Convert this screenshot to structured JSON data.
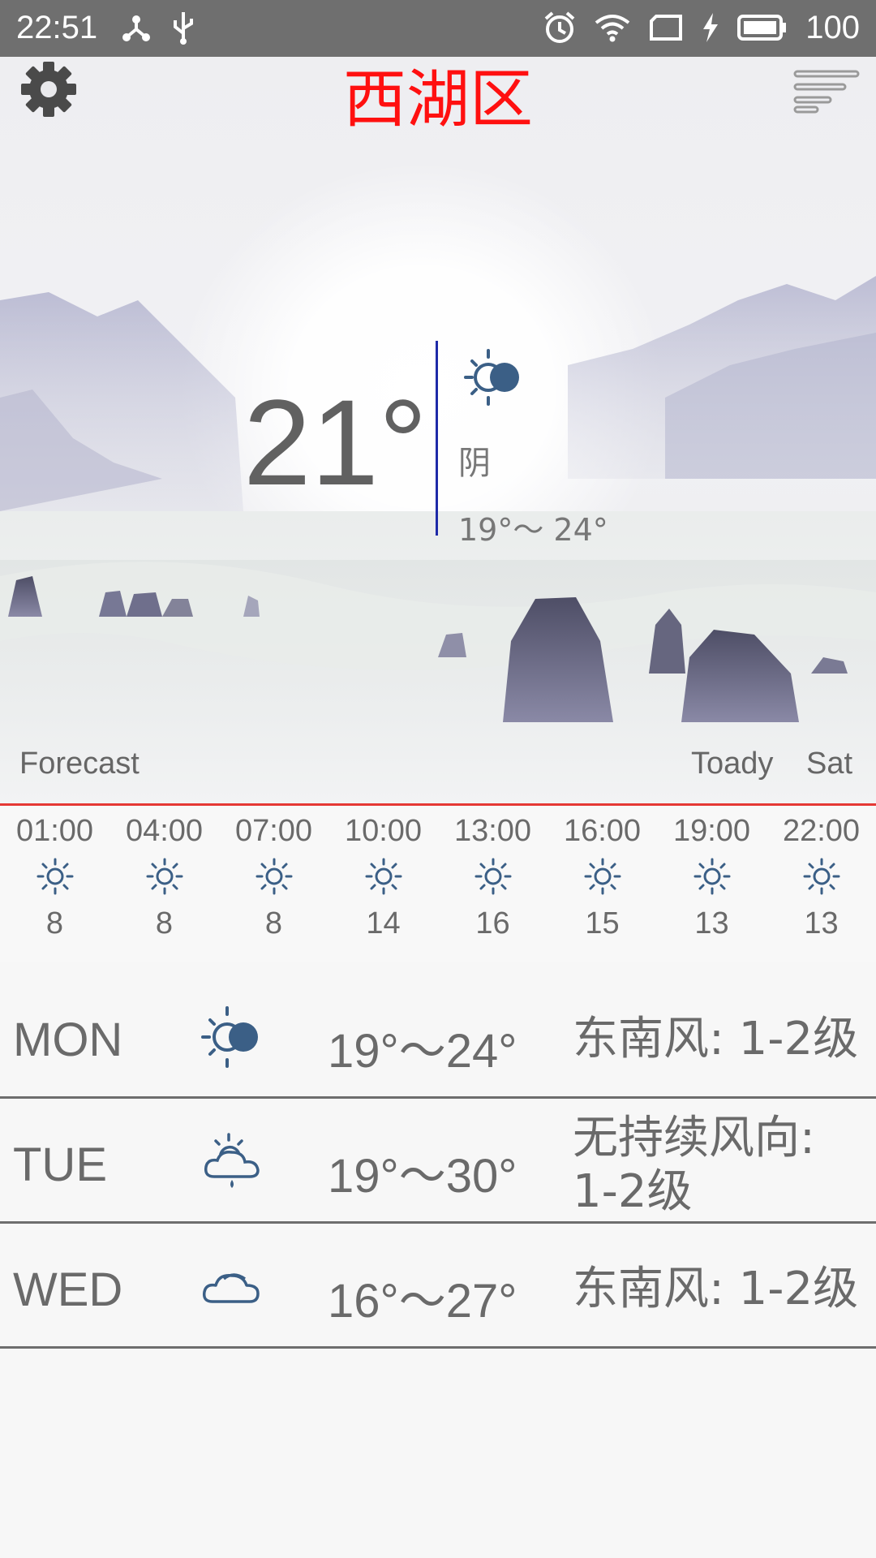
{
  "status_bar": {
    "time": "22:51",
    "battery": "100"
  },
  "header": {
    "title": "西湖区"
  },
  "current": {
    "temp": "21°",
    "condition": "阴",
    "range": "19°～ 24°",
    "icon": "sun-moon-icon"
  },
  "labels": {
    "forecast": "Forecast",
    "today": "Toady",
    "sat": "Sat"
  },
  "hourly": [
    {
      "time": "01:00",
      "value": "8",
      "icon": "sun-icon"
    },
    {
      "time": "04:00",
      "value": "8",
      "icon": "sun-icon"
    },
    {
      "time": "07:00",
      "value": "8",
      "icon": "sun-icon"
    },
    {
      "time": "10:00",
      "value": "14",
      "icon": "sun-icon"
    },
    {
      "time": "13:00",
      "value": "16",
      "icon": "sun-icon"
    },
    {
      "time": "16:00",
      "value": "15",
      "icon": "sun-icon"
    },
    {
      "time": "19:00",
      "value": "13",
      "icon": "sun-icon"
    },
    {
      "time": "22:00",
      "value": "13",
      "icon": "sun-icon"
    }
  ],
  "daily": [
    {
      "day": "MON",
      "range": "19°～24°",
      "wind": "东南风: 1-2级",
      "icon": "sun-moon-icon"
    },
    {
      "day": "TUE",
      "range": "19°～30°",
      "wind": "无持续风向: 1-2级",
      "icon": "sun-cloud-rain-icon"
    },
    {
      "day": "WED",
      "range": "16°～27°",
      "wind": "东南风: 1-2级",
      "icon": "cloud-icon"
    }
  ],
  "colors": {
    "title": "#ff1010",
    "accent_line": "#1e2aa8",
    "hero_border": "#e53935",
    "icon": "#3b5f86"
  }
}
